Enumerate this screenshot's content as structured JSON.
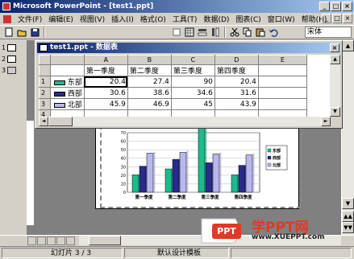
{
  "app": {
    "title": "Microsoft PowerPoint - [test1.ppt]",
    "window_buttons": [
      "_",
      "□",
      "×"
    ]
  },
  "menu": {
    "items": [
      "文件(F)",
      "编辑(E)",
      "视图(V)",
      "插入(I)",
      "格式(O)",
      "工具(T)",
      "数据(D)",
      "图表(C)",
      "窗口(W)",
      "帮助(H)"
    ],
    "doc_buttons": [
      "_",
      "□",
      "×"
    ]
  },
  "toolbar": {
    "font_name": "宋体",
    "buttons": [
      "new-icon",
      "open-icon",
      "save-icon",
      "import-file-icon",
      "view-datasheet-icon",
      "by-row-icon",
      "by-column-icon",
      "cut-icon",
      "copy-icon",
      "paste-icon",
      "undo-icon"
    ]
  },
  "slides": {
    "items": [
      {
        "label": "1"
      },
      {
        "label": "2"
      },
      {
        "label": "3"
      }
    ]
  },
  "datasheet": {
    "title": "test1.ppt - 数据表",
    "col_letters": [
      "",
      "",
      "A",
      "B",
      "C",
      "D",
      "E"
    ],
    "row_numbers": [
      "1",
      "2",
      "3",
      "4"
    ],
    "headers": [
      "第一季度",
      "第二季度",
      "第三季度",
      "第四季度"
    ],
    "rows": [
      {
        "name": "东部",
        "values": [
          "20.4",
          "27.4",
          "90",
          "20.4"
        ]
      },
      {
        "name": "西部",
        "values": [
          "30.6",
          "38.6",
          "34.6",
          "31.6"
        ]
      },
      {
        "name": "北部",
        "values": [
          "45.9",
          "46.9",
          "45",
          "43.9"
        ]
      }
    ]
  },
  "chart_data": {
    "type": "bar",
    "categories": [
      "第一季度",
      "第二季度",
      "第三季度",
      "第四季度"
    ],
    "series": [
      {
        "name": "东部",
        "values": [
          20.4,
          27.4,
          90,
          20.4
        ],
        "color": "#1abc8c"
      },
      {
        "name": "西部",
        "values": [
          30.6,
          38.6,
          34.6,
          31.6
        ],
        "color": "#2a2a8c"
      },
      {
        "name": "北部",
        "values": [
          45.9,
          46.9,
          45,
          43.9
        ],
        "color": "#b8b8ec"
      }
    ],
    "ylim": [
      0,
      100
    ],
    "yticks": [
      "0",
      "10",
      "20",
      "30",
      "40",
      "50",
      "60",
      "70"
    ],
    "legend": "right",
    "title": "",
    "xlabel": "",
    "ylabel": ""
  },
  "status": {
    "slide_info": "幻灯片 3 / 3",
    "design": "默认设计模板"
  },
  "watermark": {
    "badge": "PPT",
    "brand": "学PPT网",
    "url": "www.XUEPPT.com"
  }
}
